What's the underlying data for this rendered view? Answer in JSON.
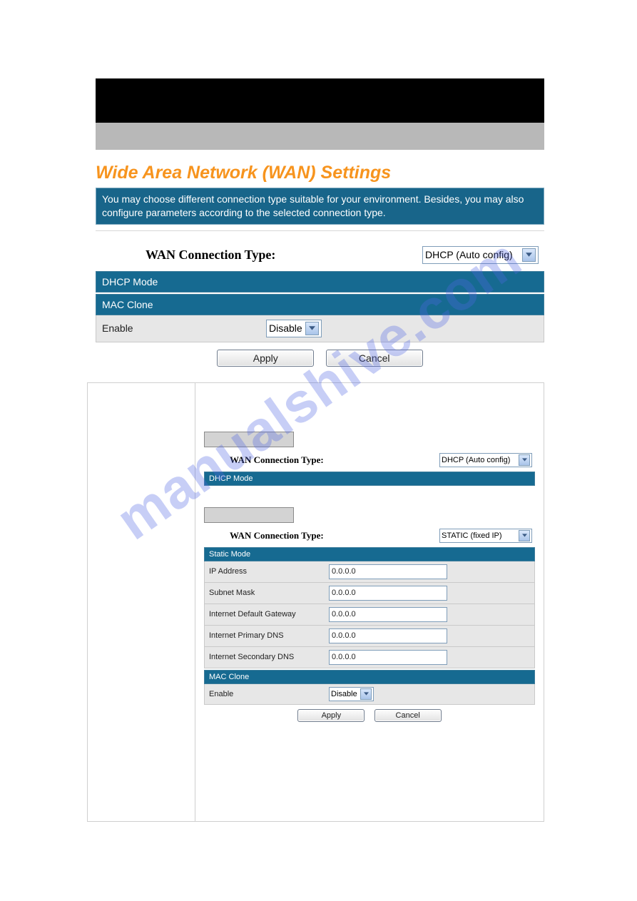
{
  "watermark": "manualshive.com",
  "panel1": {
    "title": "Wide Area Network (WAN) Settings",
    "desc": "You may choose different connection type suitable for your environment. Besides, you may also configure parameters according to the selected connection type.",
    "wan_label": "WAN Connection Type:",
    "wan_value": "DHCP (Auto config)",
    "bar_dhcp": "DHCP Mode",
    "bar_mac": "MAC Clone",
    "enable_label": "Enable",
    "enable_value": "Disable",
    "apply": "Apply",
    "cancel": "Cancel"
  },
  "panel2": {
    "wan_label": "WAN Connection Type:",
    "dhcp_select": "DHCP (Auto config)",
    "bar_dhcp": "DHCP Mode",
    "static_select": "STATIC (fixed IP)",
    "bar_static": "Static Mode",
    "fields": {
      "ip_label": "IP Address",
      "ip_value": "0.0.0.0",
      "mask_label": "Subnet Mask",
      "mask_value": "0.0.0.0",
      "gw_label": "Internet Default Gateway",
      "gw_value": "0.0.0.0",
      "dns1_label": "Internet Primary DNS",
      "dns1_value": "0.0.0.0",
      "dns2_label": "Internet Secondary DNS",
      "dns2_value": "0.0.0.0"
    },
    "bar_mac": "MAC Clone",
    "enable_label": "Enable",
    "enable_value": "Disable",
    "apply": "Apply",
    "cancel": "Cancel"
  }
}
